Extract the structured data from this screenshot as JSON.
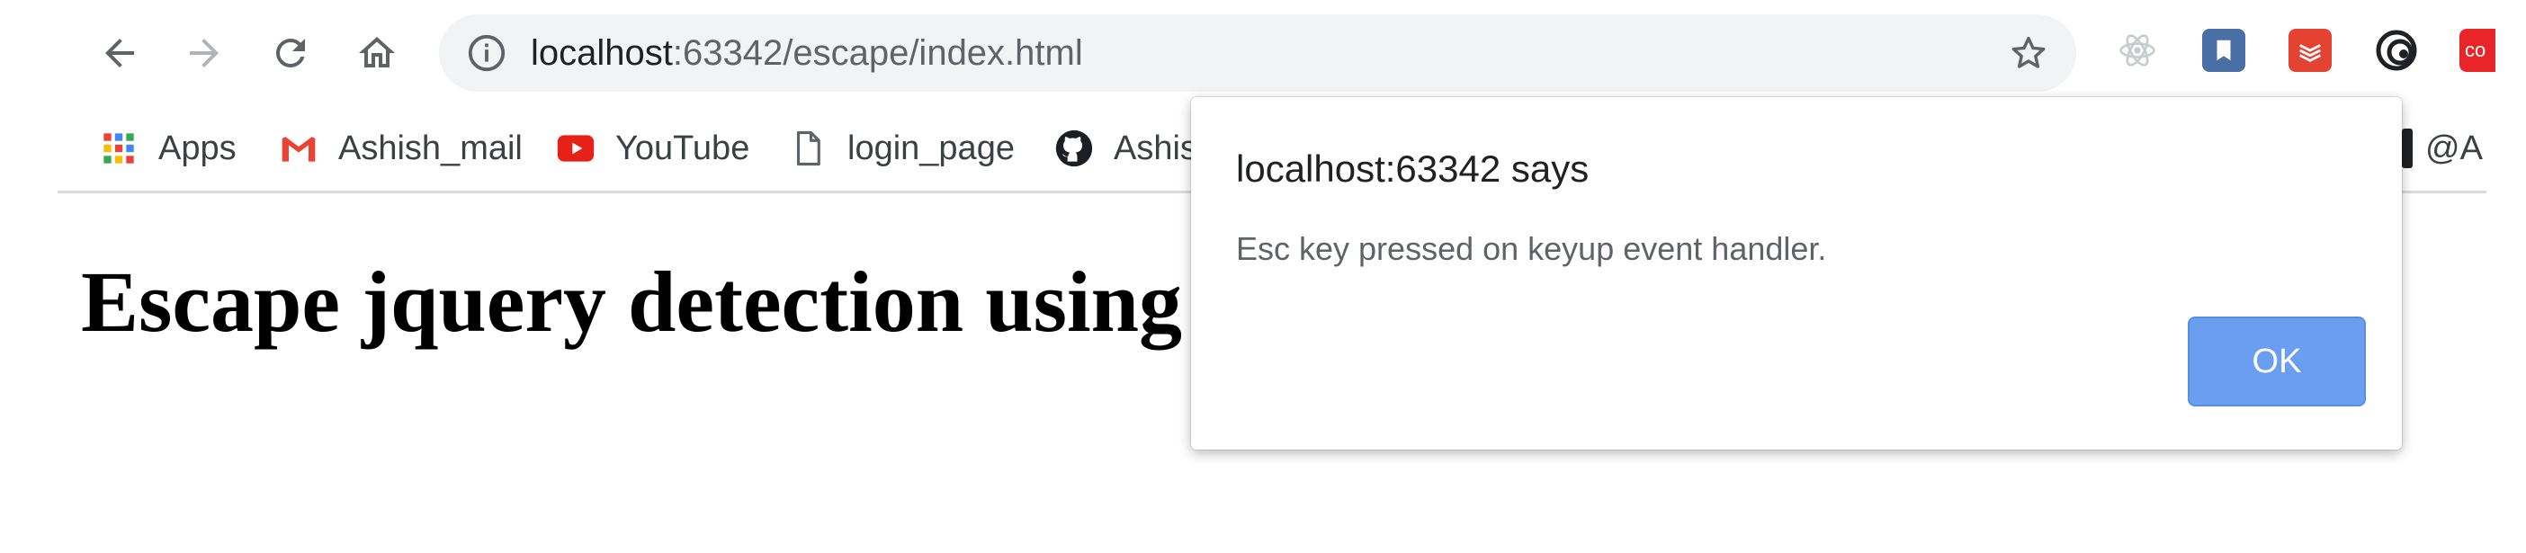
{
  "browser": {
    "url_host": "localhost",
    "url_path": ":63342/escape/index.html",
    "extensions": [
      "react-devtools-icon",
      "bookmark-extension-icon",
      "todoist-icon",
      "spiral-extension-icon",
      "red-extension-icon"
    ],
    "extension_red_label": "co"
  },
  "bookmarks": [
    {
      "label": "Apps",
      "icon": "apps-grid-icon"
    },
    {
      "label": "Ashish_mail",
      "icon": "gmail-icon"
    },
    {
      "label": "YouTube",
      "icon": "youtube-icon"
    },
    {
      "label": "login_page",
      "icon": "page-icon"
    },
    {
      "label": "Ashis",
      "icon": "github-icon"
    },
    {
      "label": "@A",
      "icon": "bookmark-icon"
    }
  ],
  "page": {
    "heading": "Escape jquery detection using"
  },
  "dialog": {
    "title": "localhost:63342 says",
    "message": "Esc key pressed on keyup event handler.",
    "ok_label": "OK"
  },
  "colors": {
    "omnibox_bg": "#f1f3f4",
    "ok_button": "#6a9ef0",
    "youtube_red": "#e62117",
    "todoist_red": "#e44332"
  }
}
